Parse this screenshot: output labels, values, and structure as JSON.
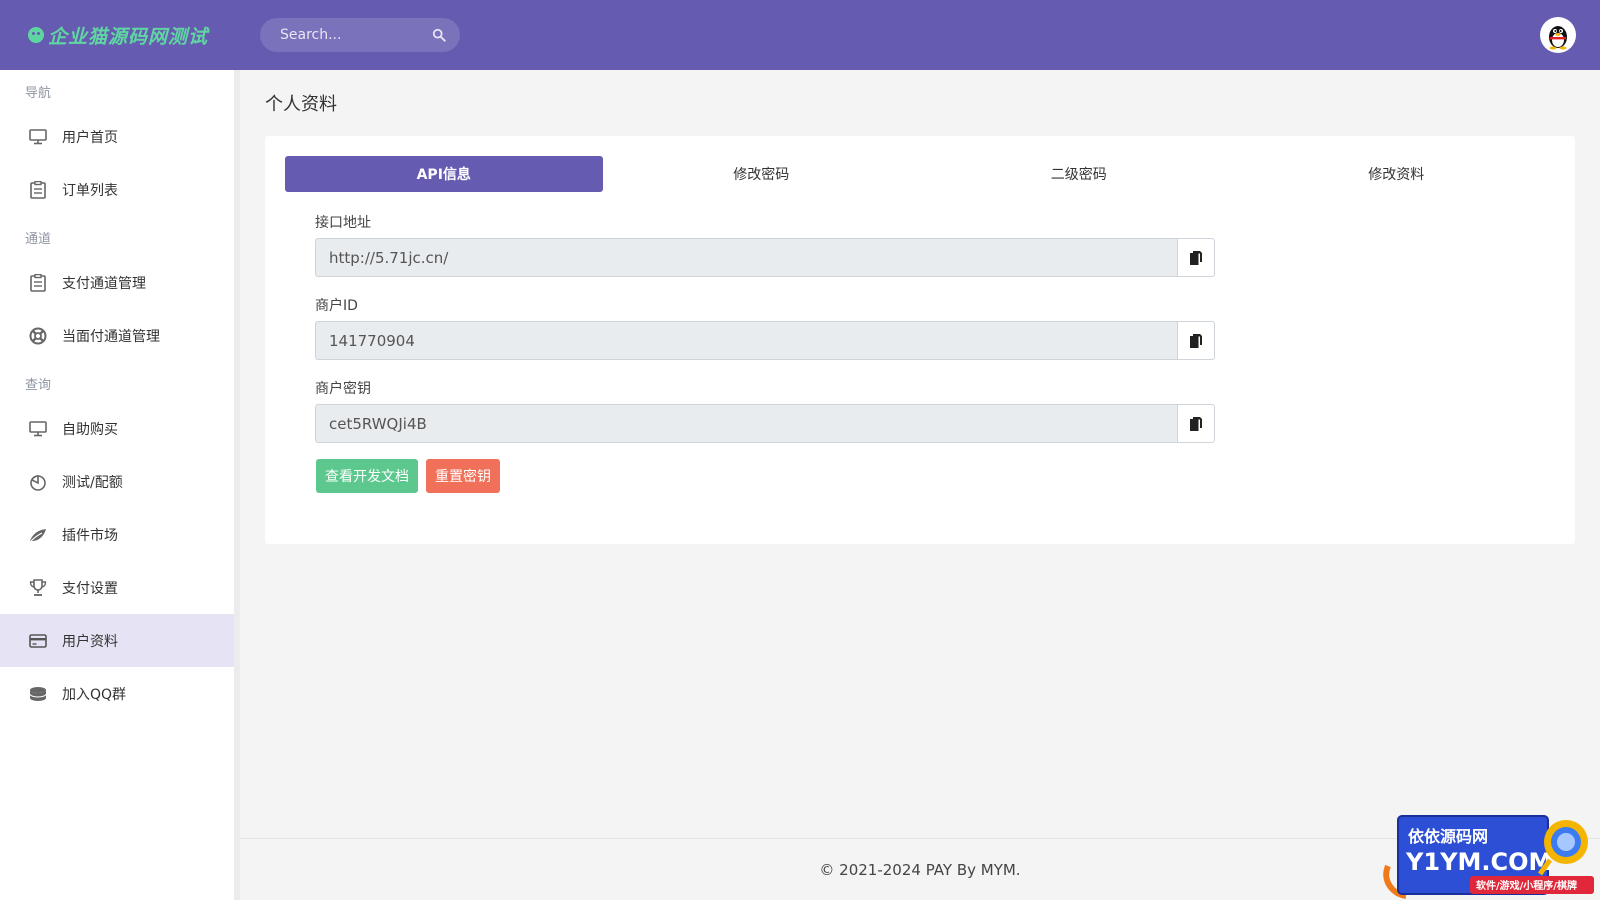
{
  "header": {
    "brand": "企业猫源码网测试",
    "search_placeholder": "Search..."
  },
  "sidebar": {
    "sections": [
      {
        "heading": "导航",
        "items": [
          {
            "label": "用户首页",
            "icon": "monitor-icon"
          },
          {
            "label": "订单列表",
            "icon": "clipboard-icon"
          }
        ]
      },
      {
        "heading": "通道",
        "items": [
          {
            "label": "支付通道管理",
            "icon": "clipboard-icon"
          },
          {
            "label": "当面付通道管理",
            "icon": "lifebuoy-icon"
          }
        ]
      },
      {
        "heading": "查询",
        "items": [
          {
            "label": "自助购买",
            "icon": "monitor-icon"
          },
          {
            "label": "测试/配额",
            "icon": "pie-chart-icon"
          },
          {
            "label": "插件市场",
            "icon": "leaf-icon"
          },
          {
            "label": "支付设置",
            "icon": "trophy-icon"
          },
          {
            "label": "用户资料",
            "icon": "credit-card-icon"
          },
          {
            "label": "加入QQ群",
            "icon": "database-icon"
          }
        ]
      }
    ],
    "active": "用户资料"
  },
  "main": {
    "title": "个人资料",
    "tabs": [
      {
        "label": "API信息",
        "active": true
      },
      {
        "label": "修改密码",
        "active": false
      },
      {
        "label": "二级密码",
        "active": false
      },
      {
        "label": "修改资料",
        "active": false
      }
    ],
    "fields": [
      {
        "label": "接口地址",
        "value": "http://5.71jc.cn/"
      },
      {
        "label": "商户ID",
        "value": "141770904"
      },
      {
        "label": "商户密钥",
        "value": "cet5RWQJi4B"
      }
    ],
    "buttons": {
      "docs": "查看开发文档",
      "reset": "重置密钥"
    }
  },
  "footer": {
    "text": "© 2021-2024 PAY By MYM."
  },
  "watermark": {
    "line1": "依依源码网",
    "line2": "Y1YM.COM",
    "line3": "软件/游戏/小程序/棋牌"
  },
  "colors": {
    "primary": "#655bb0",
    "brand_green": "#5fd6a2",
    "success": "#5cc88e",
    "danger": "#f0705a"
  }
}
